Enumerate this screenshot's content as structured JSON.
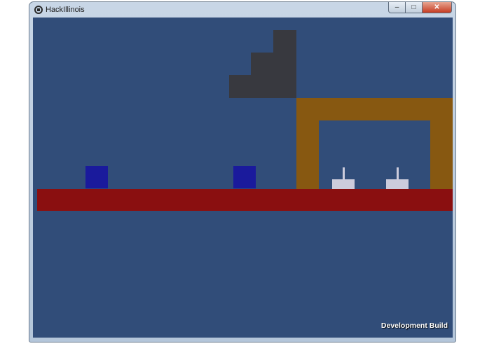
{
  "window": {
    "title": "HackIllinois",
    "icon": "unity-logo-icon",
    "buttons": {
      "minimize": "‒",
      "maximize": "□",
      "close": "✕"
    }
  },
  "game": {
    "background_color": "#314d79",
    "overlay_label": "Development Build",
    "colors": {
      "stairs": "#38393f",
      "floor": "#8a0f10",
      "beam_frame": "#875811",
      "player_block": "#1a1a9c",
      "turret": "#ccccdc"
    }
  }
}
